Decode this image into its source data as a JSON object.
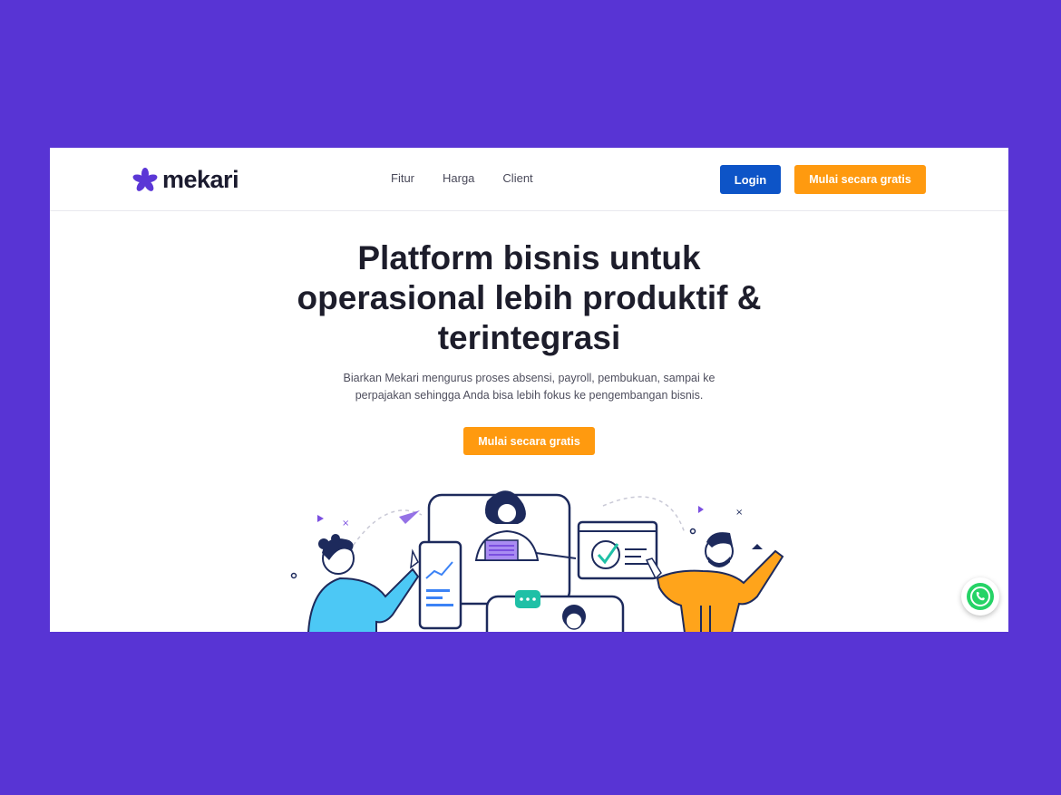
{
  "brand": {
    "name": "mekari",
    "color": "#5b37d6"
  },
  "nav": {
    "links": [
      "Fitur",
      "Harga",
      "Client"
    ],
    "login_label": "Login",
    "cta_label": "Mulai secara gratis"
  },
  "hero": {
    "title_lines": [
      "Platform bisnis untuk",
      "operasional lebih produktif &",
      "terintegrasi"
    ],
    "subtitle_lines": [
      "Biarkan Mekari mengurus proses absensi, payroll, pembukuan, sampai ke",
      "perpajakan sehingga Anda bisa lebih fokus ke pengembangan bisnis."
    ],
    "cta_label": "Mulai secara gratis"
  },
  "colors": {
    "background": "#5834d4",
    "login_button": "#0d54c7",
    "cta_button": "#ff9a0f",
    "whatsapp": "#25d366"
  },
  "icons": {
    "logo": "mekari-asterisk-icon",
    "floating": "whatsapp-icon"
  }
}
